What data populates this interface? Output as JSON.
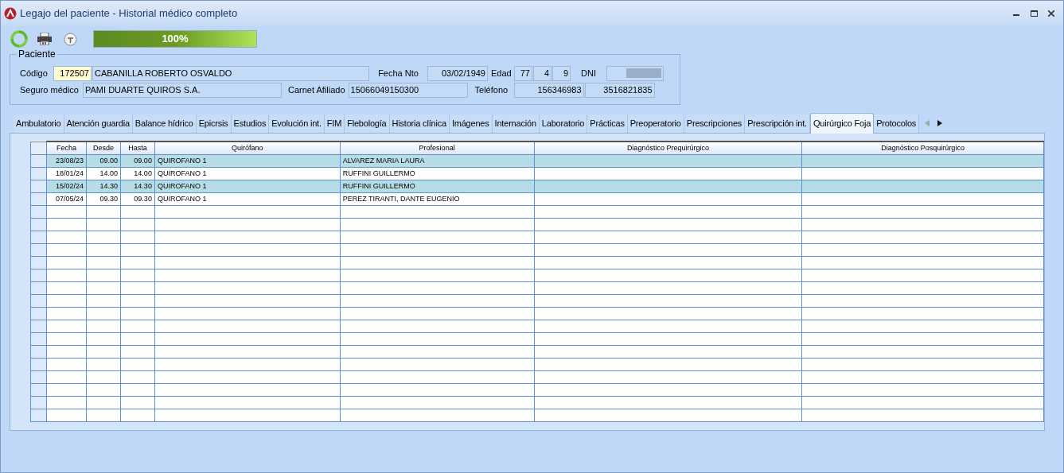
{
  "window": {
    "title": "Legajo del paciente - Historial médico completo"
  },
  "toolbar": {
    "progress": {
      "level": 1,
      "label": "100%"
    }
  },
  "patient": {
    "group_title": "Paciente",
    "codigo_label": "Código",
    "codigo": "172507",
    "nombre": "CABANILLA ROBERTO OSVALDO",
    "fecha_nto_label": "Fecha Nto",
    "fecha_nto": "03/02/1949",
    "edad_label": "Edad",
    "edad": [
      "77",
      "4",
      "9"
    ],
    "dni_label": "DNI",
    "seguro_label": "Seguro médico",
    "seguro": "PAMI DUARTE QUIROS S.A.",
    "carnet_label": "Carnet Afiliado",
    "carnet": "15066049150300",
    "telefono_label": "Teléfono",
    "telefonos": [
      "156346983",
      "3516821835"
    ]
  },
  "tabs": [
    {
      "label": "Ambulatorio",
      "selected": false
    },
    {
      "label": "Atención guardia",
      "selected": false
    },
    {
      "label": "Balance hídrico",
      "selected": false
    },
    {
      "label": "Epicrsis",
      "selected": false
    },
    {
      "label": "Estudios",
      "selected": false
    },
    {
      "label": "Evolución int.",
      "selected": false
    },
    {
      "label": "FIM",
      "selected": false
    },
    {
      "label": "Flebología",
      "selected": false
    },
    {
      "label": "Historia clínica",
      "selected": false
    },
    {
      "label": "Imágenes",
      "selected": false
    },
    {
      "label": "Internación",
      "selected": false
    },
    {
      "label": "Laboratorio",
      "selected": false
    },
    {
      "label": "Prácticas",
      "selected": false
    },
    {
      "label": "Preoperatorio",
      "selected": false
    },
    {
      "label": "Prescripciones",
      "selected": false
    },
    {
      "label": "Prescripción int.",
      "selected": false
    },
    {
      "label": "Quirúrgico Foja",
      "selected": true
    },
    {
      "label": "Protocolos",
      "selected": false
    }
  ],
  "table": {
    "columns": [
      "Fecha",
      "Desde",
      "Hasta",
      "Quirófano",
      "Profesional",
      "Diagnóstico Prequirúrgico",
      "Diagnóstico Posquirúrgico"
    ],
    "rows": [
      [
        "23/08/23",
        "09.00",
        "09.00",
        "QUIROFANO 1",
        "ALVAREZ MARIA LAURA",
        "",
        ""
      ],
      [
        "18/01/24",
        "14.00",
        "14.00",
        "QUIROFANO 1",
        "RUFFINI GUILLERMO",
        "",
        ""
      ],
      [
        "15/02/24",
        "14.30",
        "14.30",
        "QUIROFANO 1",
        "RUFFINI GUILLERMO",
        "",
        ""
      ],
      [
        "07/05/24",
        "09.30",
        "09.30",
        "QUIROFANO 1",
        "PEREZ TIRANTI, DANTE EUGENIO",
        "",
        ""
      ]
    ]
  }
}
